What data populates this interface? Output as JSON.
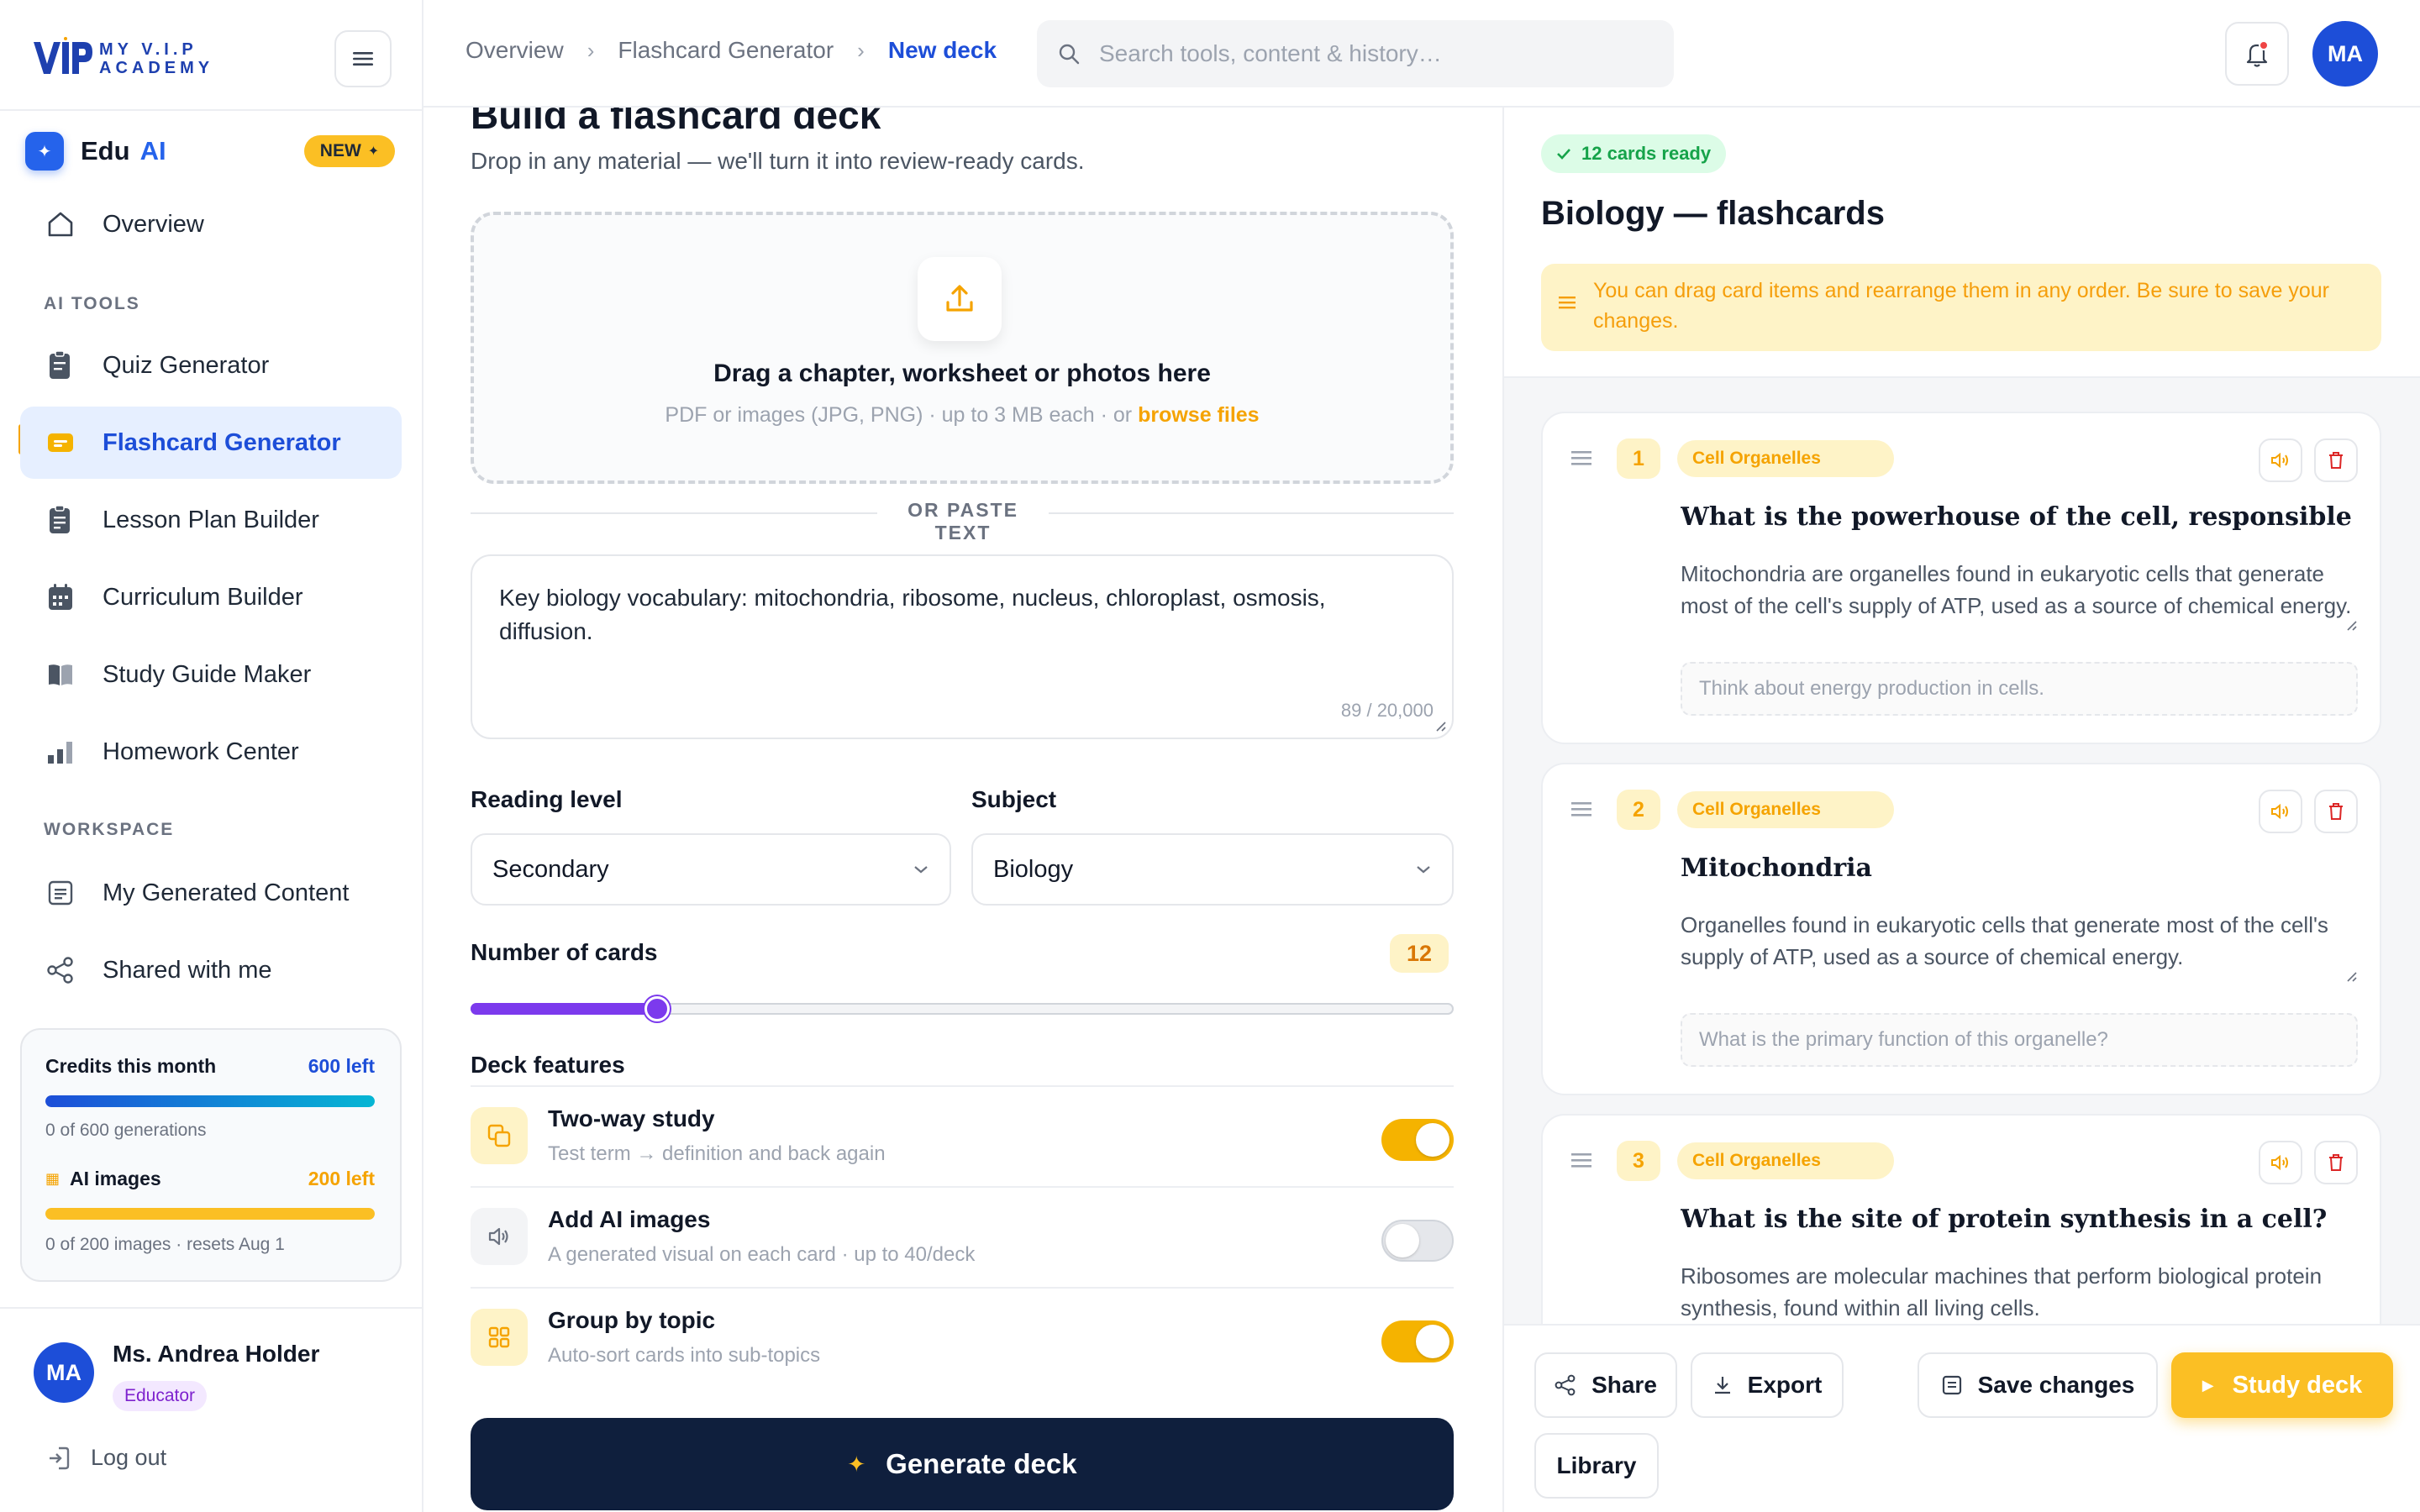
{
  "brand": {
    "line1": "MY V.I.P",
    "line2": "ACADEMY"
  },
  "sidebar": {
    "edu_label": "Edu",
    "ai_label": "AI",
    "new_badge": "NEW",
    "overview": "Overview",
    "ai_tools_heading": "AI TOOLS",
    "tools": [
      {
        "label": "Quiz Generator",
        "icon": "quiz-icon"
      },
      {
        "label": "Flashcard Generator",
        "icon": "flashcard-icon",
        "active": true
      },
      {
        "label": "Lesson Plan Builder",
        "icon": "lesson-icon"
      },
      {
        "label": "Curriculum Builder",
        "icon": "calendar-icon"
      },
      {
        "label": "Study Guide Maker",
        "icon": "book-icon"
      },
      {
        "label": "Homework Center",
        "icon": "chart-icon"
      }
    ],
    "workspace_heading": "WORKSPACE",
    "workspace": [
      {
        "label": "My Generated Content",
        "icon": "document-icon"
      },
      {
        "label": "Shared with me",
        "icon": "share-icon"
      }
    ],
    "credits": {
      "title": "Credits this month",
      "left": "600 left",
      "progress": 1.0,
      "sub": "0 of 600 generations",
      "images_title": "AI images",
      "images_left": "200 left",
      "images_progress": 1.0,
      "images_sub": "0 of 200 images · resets Aug 1"
    },
    "user": {
      "initials": "MA",
      "name": "Ms. Andrea Holder",
      "role": "Educator"
    },
    "logout": "Log out"
  },
  "topbar": {
    "breadcrumbs": [
      "Overview",
      "Flashcard Generator",
      "New deck"
    ],
    "search_placeholder": "Search tools, content & history…",
    "avatar_initials": "MA"
  },
  "main": {
    "title": "Build a flashcard deck",
    "subtitle": "Drop in any material — we'll turn it into review-ready cards.",
    "drop_title": "Drag a chapter, worksheet or photos here",
    "drop_sub": "PDF or images (JPG, PNG) · up to 3 MB each · or",
    "browse": "browse files",
    "or_paste": "OR PASTE TEXT",
    "paste_text": "Key biology vocabulary: mitochondria, ribosome, nucleus, chloroplast, osmosis, diffusion.",
    "char_count": "89 / 20,000",
    "reading_label": "Reading level",
    "reading_value": "Secondary",
    "subject_label": "Subject",
    "subject_value": "Biology",
    "cards_label": "Number of cards",
    "cards_value": "12",
    "cards_slider_fraction": 0.19,
    "features_label": "Deck features",
    "features": [
      {
        "title": "Two-way study",
        "sub": "Test term → definition and back again",
        "on": true,
        "icon": "swap-icon"
      },
      {
        "title": "Add AI images",
        "sub": "A generated visual on each card · up to 40/deck",
        "on": false,
        "icon": "speaker-icon"
      },
      {
        "title": "Group by topic",
        "sub": "Auto-sort cards into sub-topics",
        "on": true,
        "icon": "grid-icon"
      }
    ],
    "generate": "Generate deck"
  },
  "panel": {
    "ready": "12 cards ready",
    "title": "Biology — flashcards",
    "notice": "You can drag card items and rearrange them in any order. Be sure to save your changes.",
    "cards": [
      {
        "num": "1",
        "tag": "Cell Organelles",
        "question": "What is the powerhouse of the cell, responsible for gene",
        "answer": "Mitochondria are organelles found in eukaryotic cells that generate most of the cell's supply of ATP, used as a source of chemical energy.",
        "hint": "Think about energy production in cells."
      },
      {
        "num": "2",
        "tag": "Cell Organelles",
        "question": "Mitochondria",
        "answer": "Organelles found in eukaryotic cells that generate most of the cell's supply of ATP, used as a source of chemical energy.",
        "hint": "What is the primary function of this organelle?"
      },
      {
        "num": "3",
        "tag": "Cell Organelles",
        "question": "What is the site of protein synthesis in a cell?",
        "answer": "Ribosomes are molecular machines that perform biological protein synthesis, found within all living cells.",
        "hint": ""
      }
    ],
    "share": "Share",
    "export": "Export",
    "save": "Save changes",
    "study": "Study deck",
    "library": "Library"
  },
  "colors": {
    "brand_blue": "#1d4ed8",
    "accent_amber": "#fbbf24",
    "slider_purple": "#7c3aed",
    "navy_button": "#0f1f3d",
    "success_green": "#16a34a"
  }
}
